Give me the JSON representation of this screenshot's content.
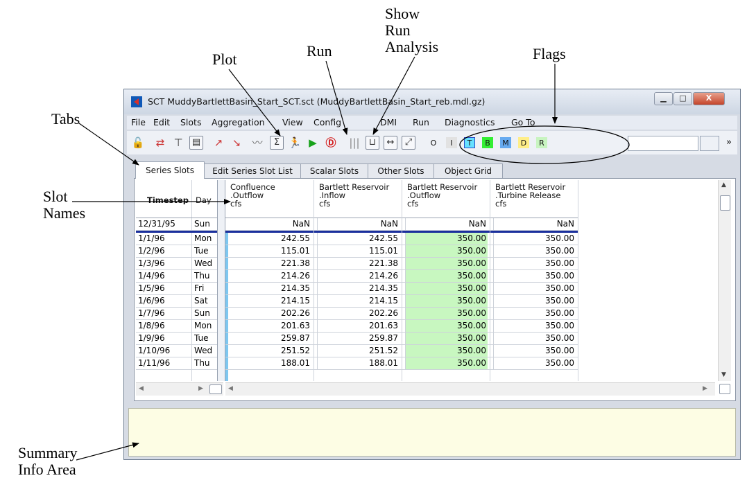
{
  "callouts": {
    "show_run_analysis": [
      "Show",
      "Run",
      "Analysis"
    ],
    "plot": "Plot",
    "run": "Run",
    "flags": "Flags",
    "tabs": "Tabs",
    "slot_names": [
      "Slot",
      "Names"
    ],
    "summary": [
      "Summary",
      "Info Area"
    ]
  },
  "window": {
    "title": "SCT MuddyBartlettBasin_Start_SCT.sct (MuddyBartlettBasin_Start_reb.mdl.gz)",
    "buttons": {
      "minimize": "▁",
      "maximize": "□",
      "close": "X"
    }
  },
  "menu": [
    "File",
    "Edit",
    "Slots",
    "Aggregation",
    "View",
    "Config",
    "DMI",
    "Run",
    "Diagnostics",
    "Go To"
  ],
  "toolbar": {
    "flags": [
      {
        "label": "O",
        "color": "#eef1f6",
        "border": "#eef1f6"
      },
      {
        "label": "I",
        "color": "#e2e2e2",
        "border": "#e2e2e2"
      },
      {
        "label": "T",
        "color": "#66e0ff",
        "border": "#2a4cc8"
      },
      {
        "label": "B",
        "color": "#33ee33",
        "border": "#33ee33"
      },
      {
        "label": "M",
        "color": "#66aaf0",
        "border": "#66aaf0"
      },
      {
        "label": "D",
        "color": "#ffee88",
        "border": "#ffee88"
      },
      {
        "label": "R",
        "color": "#c8f4c0",
        "border": "#c8f4c0"
      }
    ],
    "overflow": "»"
  },
  "tabs": [
    "Series Slots",
    "Edit Series Slot List",
    "Scalar Slots",
    "Other Slots",
    "Object Grid"
  ],
  "table": {
    "row_header_columns": [
      "Timestep",
      "Day"
    ],
    "slot_columns": [
      {
        "object": "Confluence",
        "slot": ".Outflow",
        "unit": "cfs"
      },
      {
        "object": "Bartlett Reservoir",
        "slot": ".Inflow",
        "unit": "cfs"
      },
      {
        "object": "Bartlett Reservoir",
        "slot": ".Outflow",
        "unit": "cfs"
      },
      {
        "object": "Bartlett Reservoir",
        "slot": ".Turbine Release",
        "unit": "cfs"
      }
    ],
    "initial_row": {
      "date": "12/31/95",
      "day": "Sun",
      "values": [
        "NaN",
        "NaN",
        "NaN",
        "NaN"
      ]
    },
    "rows": [
      {
        "date": "1/1/96",
        "day": "Mon",
        "values": [
          "242.55",
          "242.55",
          "350.00",
          "350.00"
        ]
      },
      {
        "date": "1/2/96",
        "day": "Tue",
        "values": [
          "115.01",
          "115.01",
          "350.00",
          "350.00"
        ]
      },
      {
        "date": "1/3/96",
        "day": "Wed",
        "values": [
          "221.38",
          "221.38",
          "350.00",
          "350.00"
        ]
      },
      {
        "date": "1/4/96",
        "day": "Thu",
        "values": [
          "214.26",
          "214.26",
          "350.00",
          "350.00"
        ]
      },
      {
        "date": "1/5/96",
        "day": "Fri",
        "values": [
          "214.35",
          "214.35",
          "350.00",
          "350.00"
        ]
      },
      {
        "date": "1/6/96",
        "day": "Sat",
        "values": [
          "214.15",
          "214.15",
          "350.00",
          "350.00"
        ]
      },
      {
        "date": "1/7/96",
        "day": "Sun",
        "values": [
          "202.26",
          "202.26",
          "350.00",
          "350.00"
        ]
      },
      {
        "date": "1/8/96",
        "day": "Mon",
        "values": [
          "201.63",
          "201.63",
          "350.00",
          "350.00"
        ]
      },
      {
        "date": "1/9/96",
        "day": "Tue",
        "values": [
          "259.87",
          "259.87",
          "350.00",
          "350.00"
        ]
      },
      {
        "date": "1/10/96",
        "day": "Wed",
        "values": [
          "251.52",
          "251.52",
          "350.00",
          "350.00"
        ]
      },
      {
        "date": "1/11/96",
        "day": "Thu",
        "values": [
          "188.01",
          "188.01",
          "350.00",
          "350.00"
        ]
      }
    ],
    "colors": {
      "outflow_highlight": "#c8f7c0",
      "column_marker": "#7ec7f0",
      "separator": "#1a2f9c"
    }
  }
}
